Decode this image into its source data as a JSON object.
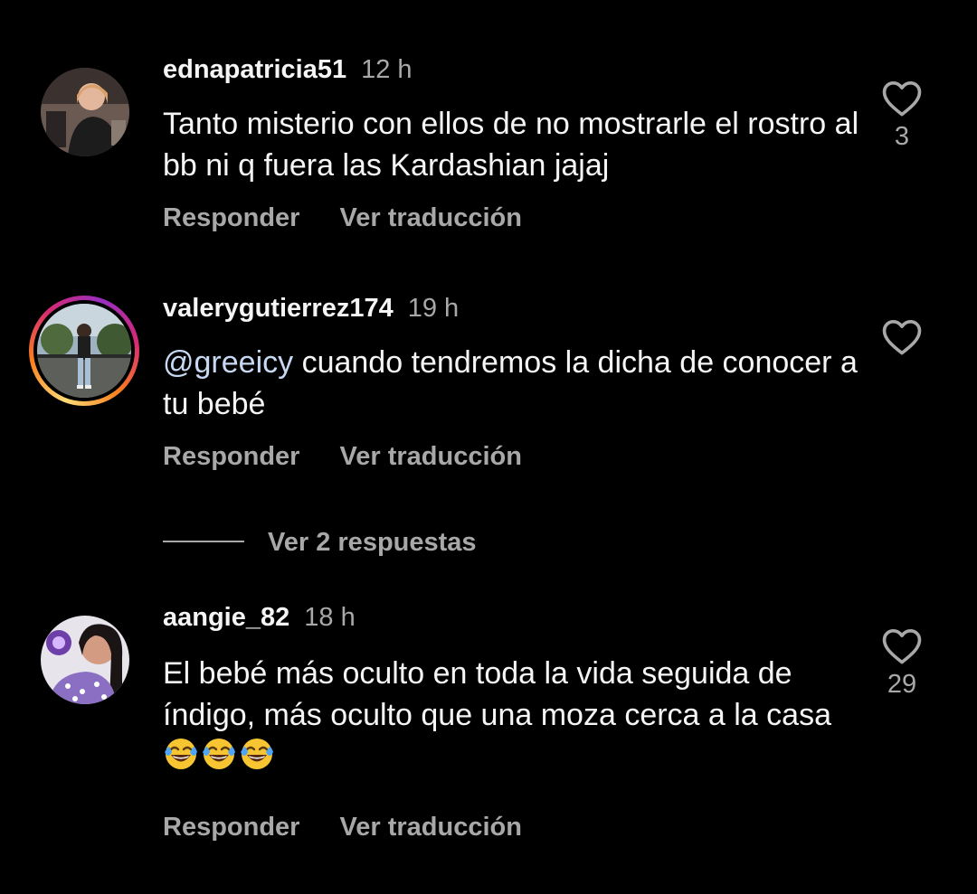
{
  "comments": [
    {
      "username": "ednapatricia51",
      "time": "12 h",
      "text": "Tanto misterio  con ellos de no mostrarle el rostro al bb ni q fuera las Kardashian jajaj",
      "likes": "3",
      "reply_label": "Responder",
      "translate_label": "Ver traducción",
      "avatar_icon": "user-photo-avatar"
    },
    {
      "username": "valerygutierrez174",
      "time": "19 h",
      "mention": "@greeicy",
      "text": " cuando tendremos la dicha de conocer a tu bebé",
      "likes": "",
      "reply_label": "Responder",
      "translate_label": "Ver traducción",
      "avatar_icon": "user-photo-avatar-story-ring",
      "replies_label": "Ver 2 respuestas"
    },
    {
      "username": "aangie_82",
      "time": "18 h",
      "text": "El bebé más oculto en toda la vida seguida de índigo, más oculto que una  moza cerca a la casa",
      "emoji": [
        "face-with-tears-of-joy",
        "face-with-tears-of-joy",
        "face-with-tears-of-joy"
      ],
      "likes": "29",
      "reply_label": "Responder",
      "translate_label": "Ver traducción",
      "avatar_icon": "user-photo-avatar"
    }
  ],
  "colors": {
    "background": "#000000",
    "primary_text": "#f5f5f5",
    "secondary_text": "#a8a8a8",
    "mention": "#c7d9f2"
  },
  "icons": {
    "like": "heart-outline-icon"
  }
}
